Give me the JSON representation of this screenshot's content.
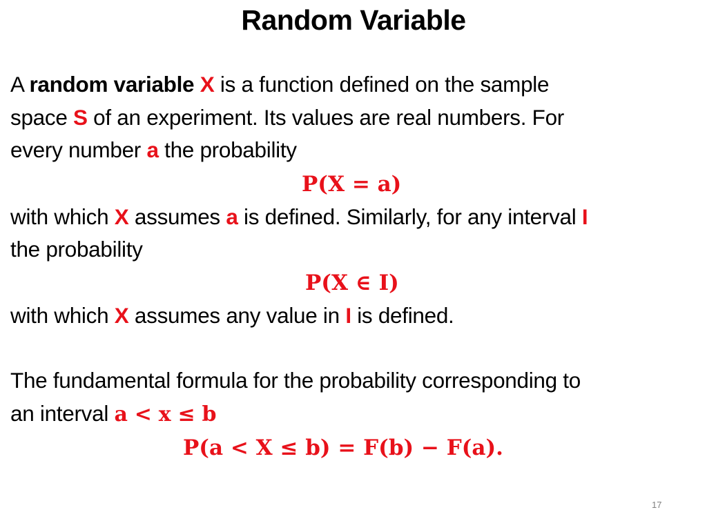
{
  "slide": {
    "title": "Random Variable",
    "page_number": "17",
    "accent_color": "#e8111a",
    "para1": {
      "l1_a": "A ",
      "l1_b": "random variable",
      "l1_c": " ",
      "l1_x": "X",
      "l1_d": " is a function defined on the sample",
      "l2_a": "space ",
      "l2_s": "S",
      "l2_b": " of an experiment. Its values are real numbers. For",
      "l3_a": "every number ",
      "l3_v": "a",
      "l3_b": " the probability"
    },
    "formula1": "P(X = a)",
    "para2": {
      "l1_a": "with which ",
      "l1_x": "X",
      "l1_b": " assumes ",
      "l1_v": "a",
      "l1_c": " is defined. Similarly, for any interval ",
      "l1_i": "I",
      "l2": "the probability"
    },
    "formula2": "P(X ∈ I)",
    "para3": {
      "l1_a": "with which ",
      "l1_x": "X",
      "l1_b": " assumes any value in ",
      "l1_i": "I",
      "l1_c": " is defined."
    },
    "para4": {
      "l1": "The fundamental formula for the probability corresponding to",
      "l2_a": "an interval ",
      "l2_m": "a < x ≤ b"
    },
    "formula3": "P(a < X ≤ b) = F(b) − F(a)."
  }
}
